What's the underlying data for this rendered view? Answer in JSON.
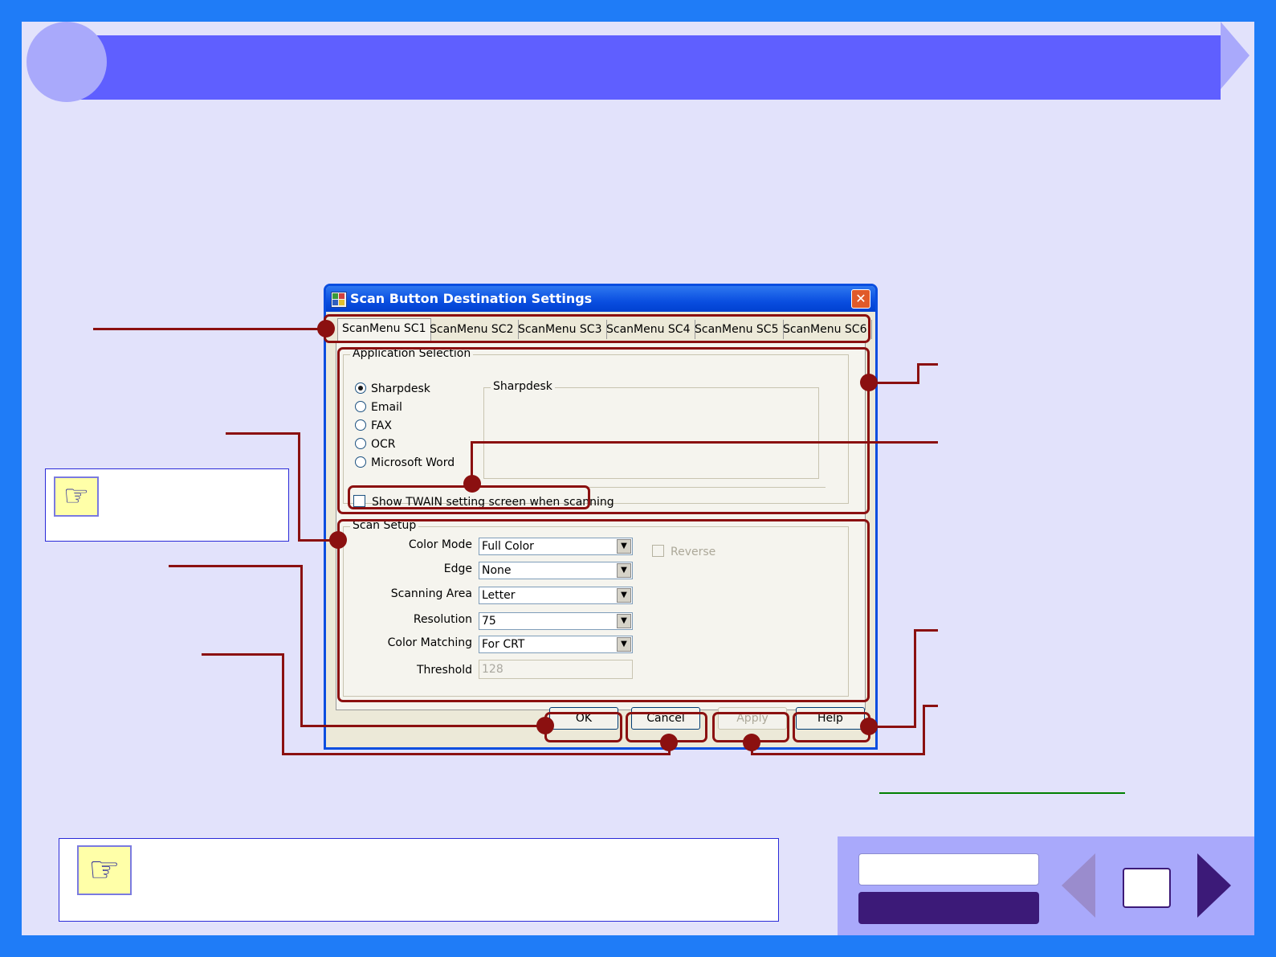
{
  "dialog": {
    "title": "Scan Button Destination Settings",
    "close_glyph": "✕",
    "tabs": [
      "ScanMenu SC1",
      "ScanMenu SC2",
      "ScanMenu SC3",
      "ScanMenu SC4",
      "ScanMenu SC5",
      "ScanMenu SC6"
    ],
    "application_selection": {
      "label": "Application Selection",
      "options": [
        "Sharpdesk",
        "Email",
        "FAX",
        "OCR",
        "Microsoft Word"
      ],
      "selected": "Sharpdesk",
      "preview_label": "Sharpdesk"
    },
    "twain_checkbox_label": "Show TWAIN setting screen when scanning",
    "scan_setup": {
      "label": "Scan Setup",
      "color_mode": {
        "label": "Color Mode",
        "value": "Full Color"
      },
      "edge": {
        "label": "Edge",
        "value": "None"
      },
      "scanning_area": {
        "label": "Scanning Area",
        "value": "Letter"
      },
      "resolution": {
        "label": "Resolution",
        "value": "75"
      },
      "color_matching": {
        "label": "Color Matching",
        "value": "For CRT"
      },
      "threshold": {
        "label": "Threshold",
        "value": "128"
      },
      "reverse_label": "Reverse"
    },
    "buttons": {
      "ok": "OK",
      "cancel": "Cancel",
      "apply": "Apply",
      "help": "Help"
    }
  },
  "icons": {
    "note": "pointing-hand-icon",
    "combo_arrow": "▼",
    "note_glyph": "☞"
  },
  "colors": {
    "page_border": "#1f7cf7",
    "background": "#e2e2fb",
    "banner": "#5f5fff",
    "callout": "#8b1010",
    "nav_dark": "#3c1a78"
  }
}
